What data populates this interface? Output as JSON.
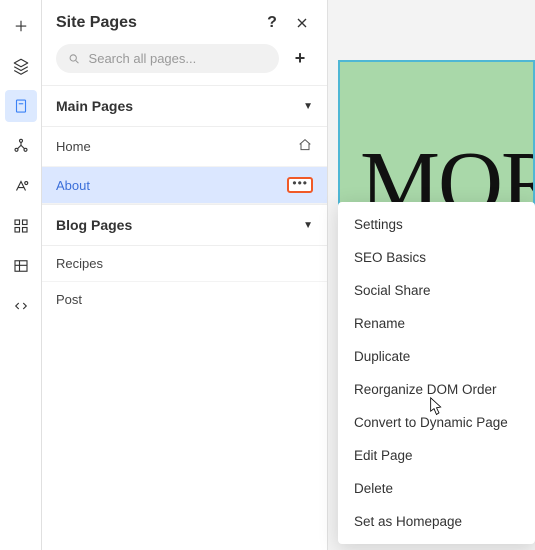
{
  "panel": {
    "title": "Site Pages",
    "help_label": "?",
    "search_placeholder": "Search all pages..."
  },
  "sections": {
    "main": {
      "title": "Main Pages"
    },
    "blog": {
      "title": "Blog Pages"
    }
  },
  "pages": {
    "home": "Home",
    "about": "About",
    "recipes": "Recipes",
    "post": "Post"
  },
  "canvas": {
    "hero_text": "MOR"
  },
  "context_menu": {
    "settings": "Settings",
    "seo": "SEO Basics",
    "social": "Social Share",
    "rename": "Rename",
    "duplicate": "Duplicate",
    "reorganize": "Reorganize DOM Order",
    "convert": "Convert to Dynamic Page",
    "edit": "Edit Page",
    "delete": "Delete",
    "homepage": "Set as Homepage"
  }
}
